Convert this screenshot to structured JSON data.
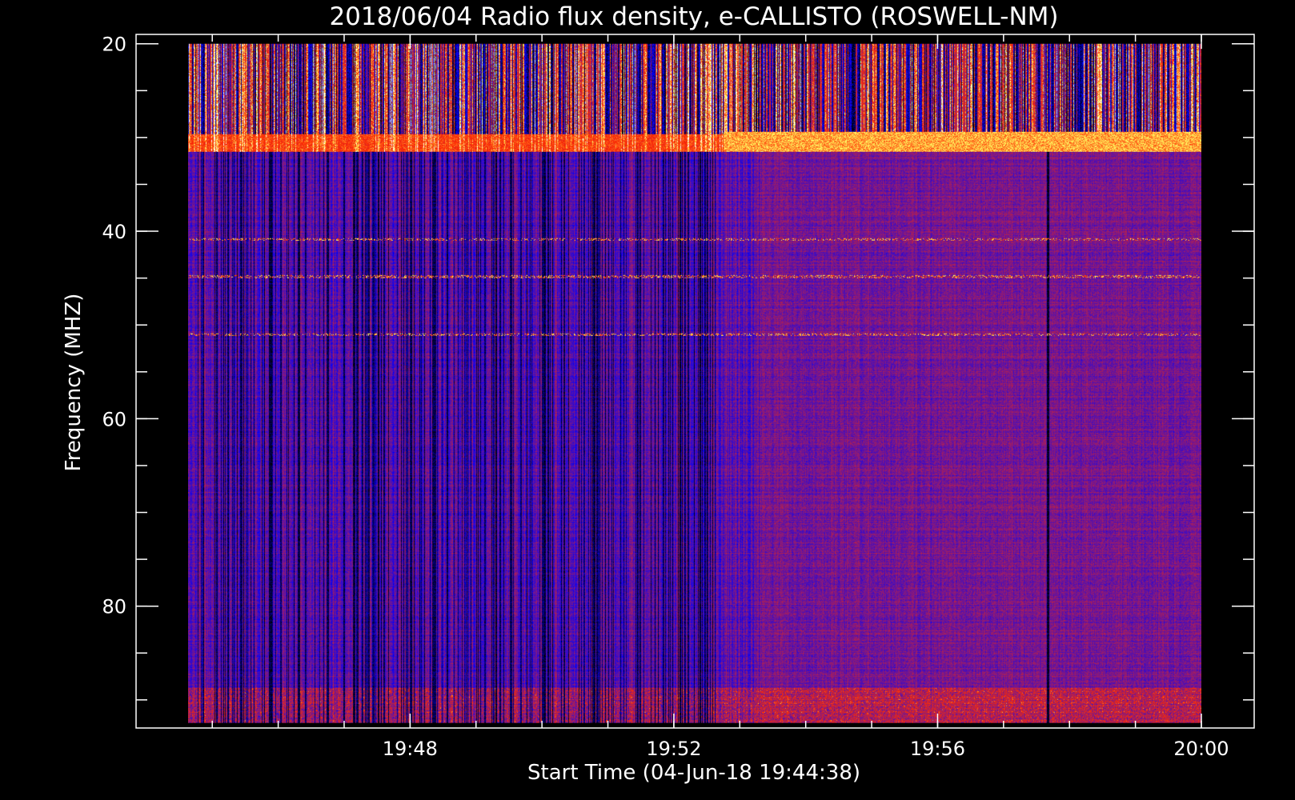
{
  "chart_data": {
    "type": "heatmap",
    "title": "2018/06/04  Radio flux density, e-CALLISTO (ROSWELL-NM)",
    "xlabel": "Start Time (04-Jun-18 19:44:38)",
    "ylabel": "Frequency (MHZ)",
    "x_start": "19:44:38",
    "x_range": [
      "19:44:38",
      "20:00:00"
    ],
    "x_ticks": [
      "19:48",
      "19:52",
      "19:56",
      "20:00"
    ],
    "x_minor_tick_interval_min": 1,
    "y_range_mhz": [
      19,
      93
    ],
    "y_data_range_mhz": [
      20,
      92.5
    ],
    "y_ticks": [
      20,
      40,
      60,
      80
    ],
    "y_minor_tick_interval_mhz": 5,
    "y_inverted": true,
    "colormap": [
      "#000000",
      "#0000ff",
      "#8a1a7a",
      "#ff2a00",
      "#ffff60",
      "#ffffff"
    ],
    "features": {
      "low_freq_rfi_band_mhz": [
        20,
        31.5
      ],
      "quiet_period_end": "19:52:45",
      "dark_column_time": "19:57:40",
      "bright_rfi_lines_mhz": [
        40.8,
        44.8,
        51
      ]
    }
  }
}
